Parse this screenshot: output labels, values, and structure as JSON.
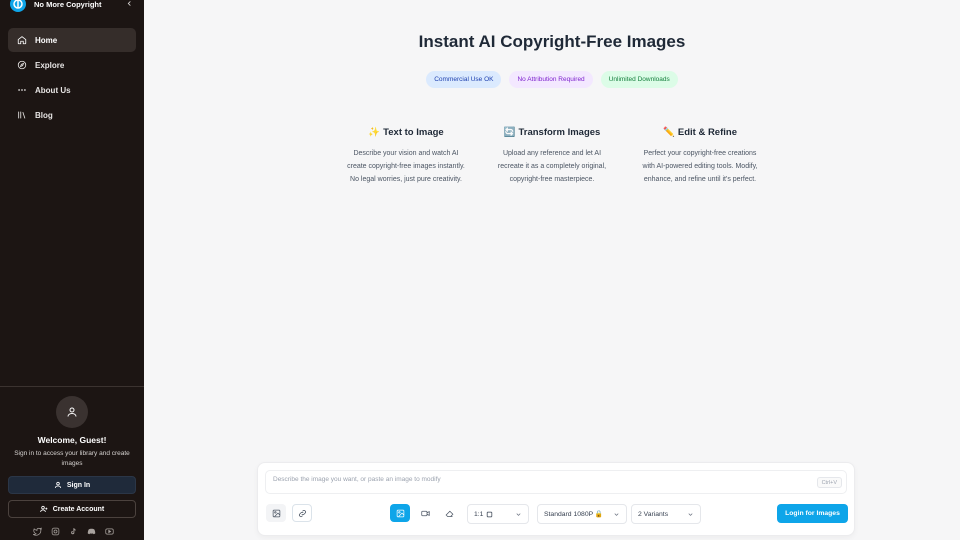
{
  "brand": {
    "name": "No More Copyright"
  },
  "sidebar": {
    "items": [
      {
        "label": "Home",
        "icon": "home-icon",
        "active": true
      },
      {
        "label": "Explore",
        "icon": "compass-icon"
      },
      {
        "label": "About Us",
        "icon": "ellipsis-icon"
      },
      {
        "label": "Blog",
        "icon": "library-icon"
      }
    ],
    "welcome": "Welcome, Guest!",
    "welcome_sub": "Sign in to access your library and create images",
    "signin_label": "Sign In",
    "create_label": "Create Account",
    "socials": [
      "twitter-icon",
      "instagram-icon",
      "tiktok-icon",
      "discord-icon",
      "youtube-icon"
    ]
  },
  "main": {
    "title": "Instant AI Copyright-Free Images",
    "badges": [
      {
        "label": "Commercial Use OK",
        "color": "#1e40af"
      },
      {
        "label": "No Attribution Required",
        "color": "#7e22ce"
      },
      {
        "label": "Unlimited Downloads",
        "color": "#15803d"
      }
    ],
    "features": [
      {
        "emoji": "✨",
        "title": "Text to Image",
        "desc": "Describe your vision and watch AI create copyright-free images instantly. No legal worries, just pure creativity."
      },
      {
        "emoji": "🔄",
        "title": "Transform Images",
        "desc": "Upload any reference and let AI recreate it as a completely original, copyright-free masterpiece."
      },
      {
        "emoji": "✏️",
        "title": "Edit & Refine",
        "desc": "Perfect your copyright-free creations with AI-powered editing tools. Modify, enhance, and refine until it's perfect."
      }
    ]
  },
  "composer": {
    "placeholder": "Describe the image you want, or paste an image to modify",
    "shortcut": "Ctrl+V",
    "aspect_ratio": "1:1",
    "quality": "Standard 1080P 🔒",
    "variants": "2 Variants",
    "login_label": "Login for Images",
    "accent": "#0ea5e9"
  }
}
